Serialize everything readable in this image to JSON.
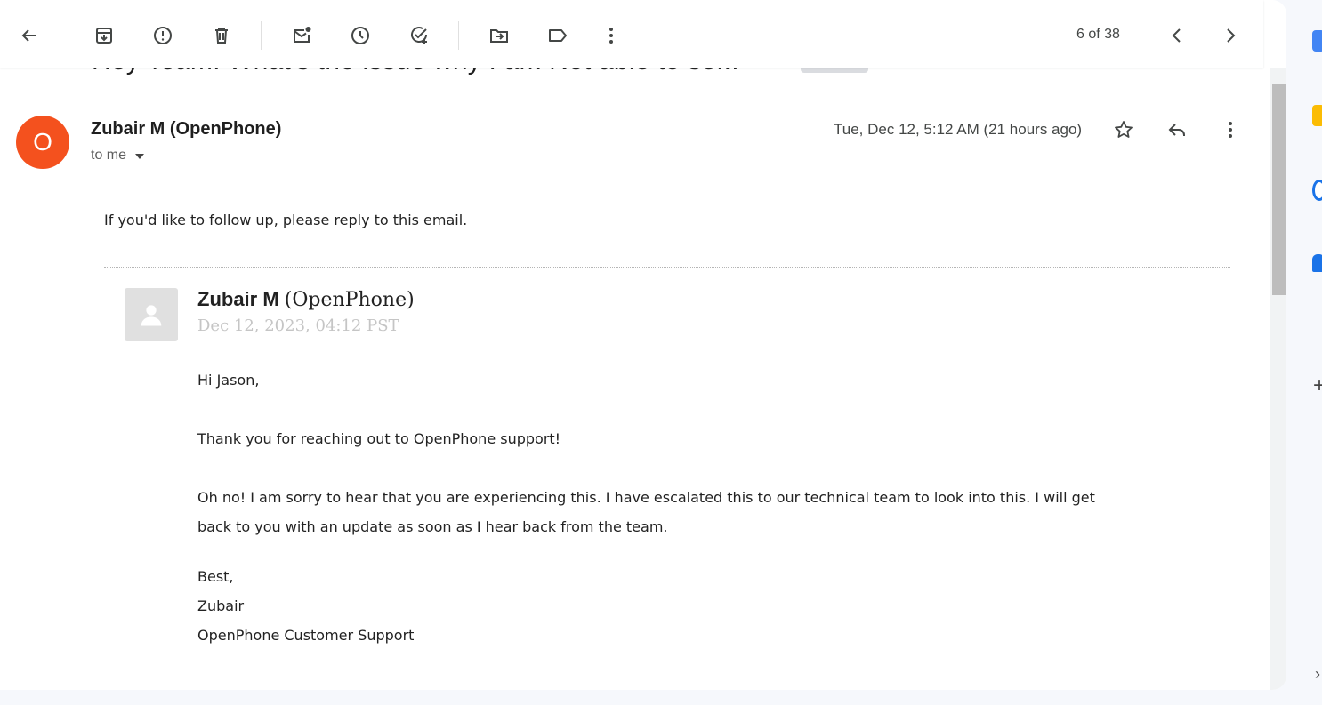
{
  "toolbar": {
    "buttons": [
      {
        "name": "back-button",
        "icon": "arrow-left-icon"
      },
      {
        "name": "archive-button",
        "icon": "archive-icon"
      },
      {
        "name": "report-spam-button",
        "icon": "report-icon"
      },
      {
        "name": "delete-button",
        "icon": "trash-icon"
      },
      {
        "name": "mark-unread-button",
        "icon": "mail-unread-icon"
      },
      {
        "name": "snooze-button",
        "icon": "clock-icon"
      },
      {
        "name": "add-task-button",
        "icon": "add-task-icon"
      },
      {
        "name": "move-to-button",
        "icon": "folder-move-icon"
      },
      {
        "name": "labels-button",
        "icon": "label-icon"
      },
      {
        "name": "more-button",
        "icon": "more-vert-icon"
      }
    ],
    "pager": "6 of 38"
  },
  "subject": "Hey Team. What's the issue why I am Not able to se...",
  "message": {
    "avatar_letter": "O",
    "avatar_color": "#f4511e",
    "sender": "Zubair M (OpenPhone)",
    "to": "to me",
    "timestamp": "Tue, Dec 12, 5:12 AM (21 hours ago)",
    "intro": "If you'd like to follow up, please reply to this email."
  },
  "quoted": {
    "name_bold": "Zubair M",
    "name_org": "(OpenPhone)",
    "date": "Dec 12, 2023, 04:12 PST",
    "greeting": "Hi Jason,",
    "line1": "Thank you for reaching out to OpenPhone support!",
    "line2a": "Oh no! I am sorry to hear that you are experiencing this. I have escalated this to our technical team to look into this. I will get",
    "line2b": "back to you with an update as soon as I hear back from the team.",
    "sign1": "Best,",
    "sign2": "Zubair",
    "sign3": "OpenPhone Customer Support"
  },
  "rail": {
    "colors": [
      "#4285f4",
      "#fbbc04",
      "#1a73e8",
      "#1a73e8"
    ]
  }
}
